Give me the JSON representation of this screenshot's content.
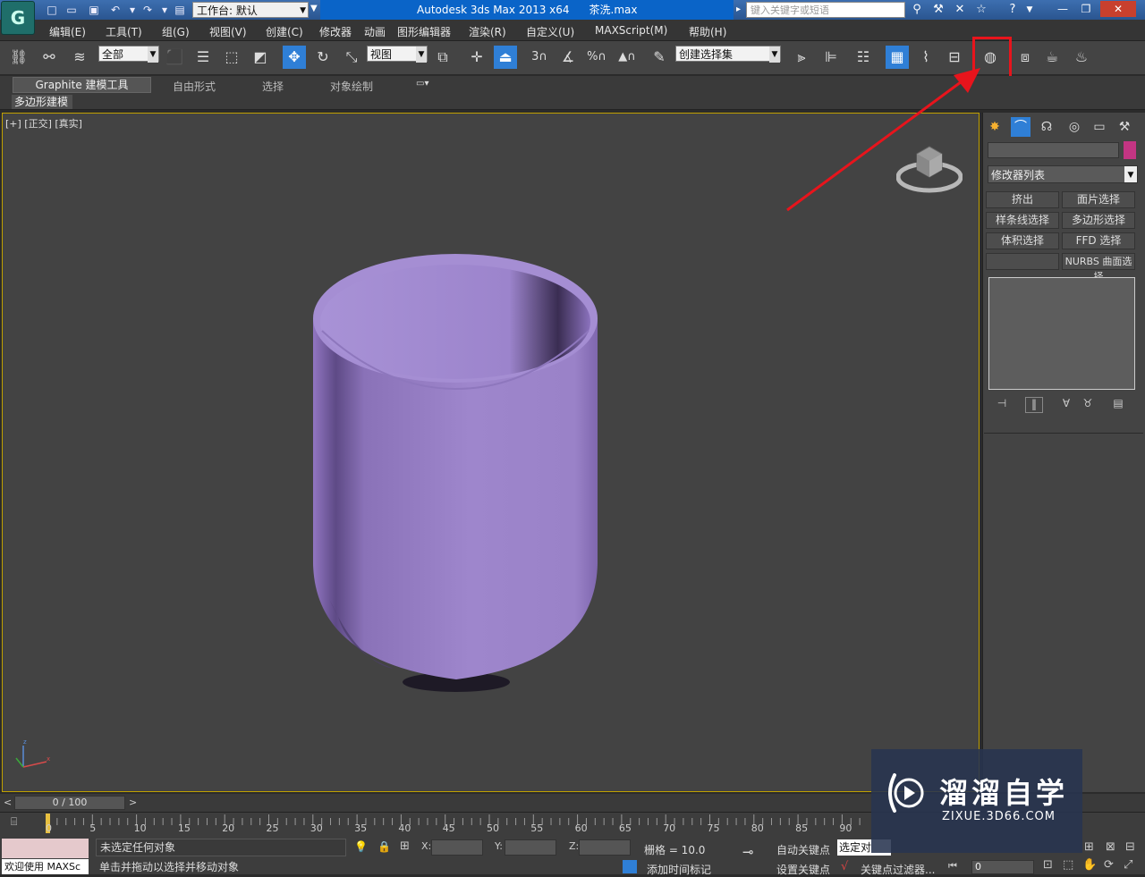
{
  "title": {
    "workspace": "工作台: 默认",
    "app": "Autodesk 3ds Max  2013 x64",
    "file": "茶洗.max",
    "search_placeholder": "键入关键字或短语"
  },
  "menu": [
    "编辑(E)",
    "工具(T)",
    "组(G)",
    "视图(V)",
    "创建(C)",
    "修改器",
    "动画",
    "图形编辑器",
    "渲染(R)",
    "自定义(U)",
    "MAXScript(M)",
    "帮助(H)"
  ],
  "toolbar": {
    "selection_filter": "全部",
    "reference_coord": "视图",
    "named_selection": "创建选择集"
  },
  "ribbon": {
    "tabs": [
      "Graphite 建模工具",
      "自由形式",
      "选择",
      "对象绘制"
    ],
    "sub": "多边形建模"
  },
  "viewport": {
    "label": "[+] [正交] [真实]",
    "cup_color": "#9a80c6"
  },
  "command_panel": {
    "modifier_list": "修改器列表",
    "buttons": [
      "挤出",
      "面片选择",
      "样条线选择",
      "多边形选择",
      "体积选择",
      "FFD 选择",
      "",
      "NURBS 曲面选择"
    ],
    "object_color": "#c33583"
  },
  "timeline": {
    "frame": "0 / 100",
    "ticks": [
      "0",
      "5",
      "10",
      "15",
      "20",
      "25",
      "30",
      "35",
      "40",
      "45",
      "50",
      "55",
      "60",
      "65",
      "70",
      "75",
      "80",
      "85",
      "90"
    ]
  },
  "status": {
    "welcome": "欢迎使用 MAXSc",
    "selection": "未选定任何对象",
    "prompt": "单击并拖动以选择并移动对象",
    "x_label": "X:",
    "y_label": "Y:",
    "z_label": "Z:",
    "grid": "栅格 = 10.0",
    "auto_key": "自动关键点",
    "set_key": "设置关键点",
    "selected_obj": "选定对",
    "key_filter": "关键点过滤器...",
    "add_time_tag": "添加时间标记",
    "frame_field": "0"
  },
  "watermark": {
    "title": "溜溜自学",
    "url": "ZIXUE.3D66.COM"
  },
  "colors": {
    "title_active": "#0a64c8",
    "highlight_box": "#e8141c",
    "arrow": "#e8141c"
  }
}
